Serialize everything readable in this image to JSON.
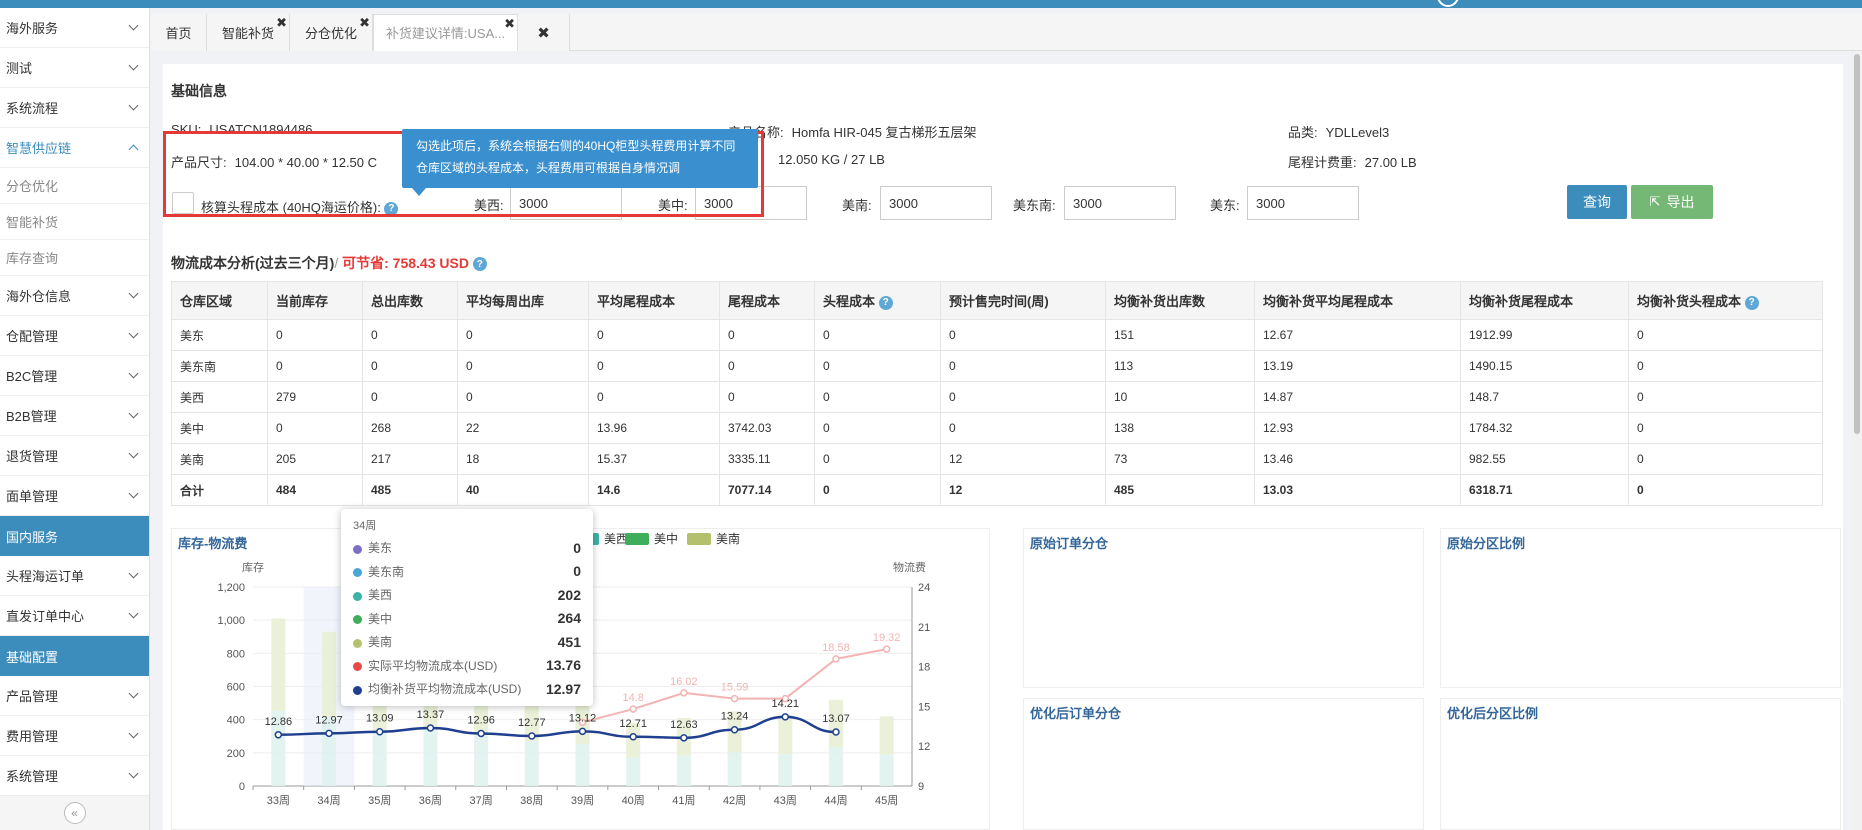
{
  "sidebar": {
    "items": [
      {
        "label": "海外服务",
        "type": "item"
      },
      {
        "label": "测试",
        "type": "item"
      },
      {
        "label": "系统流程",
        "type": "item"
      },
      {
        "label": "智慧供应链",
        "type": "open"
      },
      {
        "label": "分仓优化",
        "type": "sub"
      },
      {
        "label": "智能补货",
        "type": "sub"
      },
      {
        "label": "库存查询",
        "type": "sub"
      },
      {
        "label": "海外仓信息",
        "type": "item"
      },
      {
        "label": "仓配管理",
        "type": "item"
      },
      {
        "label": "B2C管理",
        "type": "item"
      },
      {
        "label": "B2B管理",
        "type": "item"
      },
      {
        "label": "退货管理",
        "type": "item"
      },
      {
        "label": "面单管理",
        "type": "item"
      },
      {
        "label": "国内服务",
        "type": "section"
      },
      {
        "label": "头程海运订单",
        "type": "item"
      },
      {
        "label": "直发订单中心",
        "type": "item"
      },
      {
        "label": "基础配置",
        "type": "section"
      },
      {
        "label": "产品管理",
        "type": "item"
      },
      {
        "label": "费用管理",
        "type": "item"
      },
      {
        "label": "系统管理",
        "type": "item"
      }
    ],
    "collapse_glyph": "«"
  },
  "tabs": [
    {
      "label": "首页"
    },
    {
      "label": "智能补货"
    },
    {
      "label": "分仓优化"
    },
    {
      "label": "补货建议详情:USA..."
    }
  ],
  "close_glyph": "✖",
  "basic": {
    "title": "基础信息",
    "sku_label": "SKU:",
    "sku_value": "USATCN1894486",
    "product_name_label": "产品名称:",
    "product_name_value": "Homfa HIR-045 复古梯形五层架",
    "category_label": "品类:",
    "category_value": "YDLLevel3",
    "size_label": "产品尺寸:",
    "size_value": "104.00 * 40.00 * 12.50 C",
    "weight_value": "12.050 KG / 27 LB",
    "tail_weight_label": "尾程计费重:",
    "tail_weight_value": "27.00 LB",
    "tooltip_line1": "勾选此项后，系统会根据右侧的40HQ柜型头程费用计算不同",
    "tooltip_line2": "仓库区域的头程成本，头程费用可根据自身情况调",
    "calc_label": "核算头程成本 (40HQ海运价格):",
    "prices": [
      {
        "label": "美西:",
        "value": "3000"
      },
      {
        "label": "美中:",
        "value": "3000"
      },
      {
        "label": "美南:",
        "value": "3000"
      },
      {
        "label": "美东南:",
        "value": "3000"
      },
      {
        "label": "美东:",
        "value": "3000"
      }
    ],
    "btn_query": "查询",
    "btn_export": "导出"
  },
  "analysis": {
    "title": "物流成本分析(过去三个月)",
    "saving": "可节省: 758.43 USD",
    "headers": [
      "仓库区域",
      "当前库存",
      "总出库数",
      "平均每周出库",
      "平均尾程成本",
      "尾程成本",
      "头程成本",
      "预计售完时间(周)",
      "均衡补货出库数",
      "均衡补货平均尾程成本",
      "均衡补货尾程成本",
      "均衡补货头程成本"
    ],
    "rows": [
      [
        "美东",
        "0",
        "0",
        "0",
        "0",
        "0",
        "0",
        "0",
        "151",
        "12.67",
        "1912.99",
        "0"
      ],
      [
        "美东南",
        "0",
        "0",
        "0",
        "0",
        "0",
        "0",
        "0",
        "113",
        "13.19",
        "1490.15",
        "0"
      ],
      [
        "美西",
        "279",
        "0",
        "0",
        "0",
        "0",
        "0",
        "0",
        "10",
        "14.87",
        "148.7",
        "0"
      ],
      [
        "美中",
        "0",
        "268",
        "22",
        "13.96",
        "3742.03",
        "0",
        "0",
        "138",
        "12.93",
        "1784.32",
        "0"
      ],
      [
        "美南",
        "205",
        "217",
        "18",
        "15.37",
        "3335.11",
        "0",
        "12",
        "73",
        "13.46",
        "982.55",
        "0"
      ],
      [
        "合计",
        "484",
        "485",
        "40",
        "14.6",
        "7077.14",
        "0",
        "12",
        "485",
        "13.03",
        "6318.71",
        "0"
      ]
    ]
  },
  "chart_titles": {
    "main": "库存-物流费",
    "orig_order": "原始订单分仓",
    "orig_ratio": "原始分区比例",
    "opt_order": "优化后订单分仓",
    "opt_ratio": "优化后分区比例"
  },
  "chart_data": {
    "type": "bar",
    "categories": [
      "33周",
      "34周",
      "35周",
      "36周",
      "37周",
      "38周",
      "39周",
      "40周",
      "41周",
      "42周",
      "43周",
      "44周",
      "45周"
    ],
    "ylabel": "库存",
    "y2label": "物流费",
    "ylim": [
      0,
      1200
    ],
    "y2lim": [
      9,
      24
    ],
    "yticks": [
      "0",
      "200",
      "400",
      "600",
      "800",
      "1,000",
      "1,200"
    ],
    "y2ticks": [
      "9",
      "12",
      "15",
      "18",
      "21",
      "24"
    ],
    "legend_visible": [
      {
        "name": "美西",
        "color": "#3bb3a6"
      },
      {
        "name": "美中",
        "color": "#3eae5b"
      },
      {
        "name": "美南",
        "color": "#b5c06e"
      }
    ],
    "stack_totals": [
      1010,
      930,
      730,
      770,
      700,
      600,
      560,
      380,
      410,
      450,
      430,
      520,
      420
    ],
    "series": [
      {
        "name": "实际平均物流成本(USD)",
        "color": "#f3b3b3",
        "values": [
          null,
          null,
          null,
          null,
          null,
          null,
          13.8,
          14.8,
          16.02,
          15.59,
          15.59,
          18.58,
          19.32
        ]
      },
      {
        "name": "均衡补货平均物流成本(USD)",
        "color": "#1f3f8f",
        "values": [
          12.86,
          12.97,
          13.09,
          13.37,
          12.96,
          12.77,
          13.12,
          12.71,
          12.63,
          13.24,
          14.21,
          13.07
        ]
      }
    ],
    "line_labels": [
      "12.86",
      "12.97",
      "13.09",
      "13.37",
      "12.96",
      "12.77",
      "13.12",
      "12.71",
      "12.63",
      "13.24",
      "14.21",
      "13.07"
    ],
    "pink_labels": [
      "14.8",
      "16.02",
      "15.59",
      "18.58",
      "19.32"
    ],
    "hover_week": "34周",
    "tooltip_rows": [
      {
        "name": "美东",
        "value": "0",
        "color": "#7b6fc9"
      },
      {
        "name": "美东南",
        "value": "0",
        "color": "#4aa6d9"
      },
      {
        "name": "美西",
        "value": "202",
        "color": "#3bb3a6"
      },
      {
        "name": "美中",
        "value": "264",
        "color": "#3eae5b"
      },
      {
        "name": "美南",
        "value": "451",
        "color": "#b5c06e"
      },
      {
        "name": "实际平均物流成本(USD)",
        "value": "13.76",
        "color": "#e84a4a"
      },
      {
        "name": "均衡补货平均物流成本(USD)",
        "value": "12.97",
        "color": "#1f3f8f"
      }
    ]
  }
}
